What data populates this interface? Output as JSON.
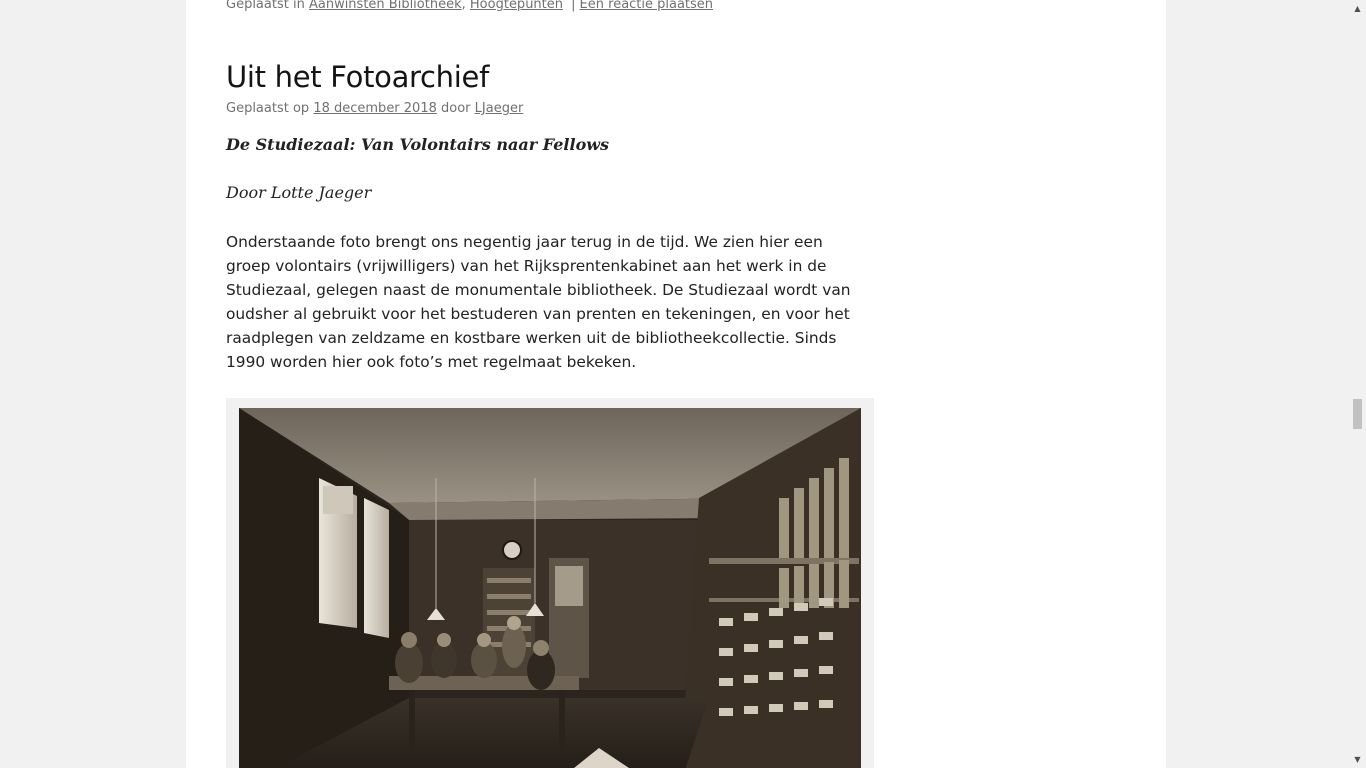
{
  "previous_post": {
    "posted_in_label": "Geplaatst in",
    "categories": [
      "Aanwinsten Bibliotheek",
      "Hoogtepunten"
    ],
    "comma": ",",
    "separator": "|",
    "comment_link": "Een reactie plaatsen"
  },
  "post": {
    "title": "Uit het Fotoarchief",
    "meta": {
      "posted_on_label": "Geplaatst op",
      "date": "18 december 2018",
      "by_label": "door",
      "author": "LJaeger"
    },
    "subtitle": "De Studiezaal: Van Volontairs naar Fellows",
    "byline": "Door Lotte Jaeger",
    "paragraph": "Onderstaande foto brengt ons negentig jaar terug in de tijd. We zien hier een groep volontairs (vrijwilligers) van het Rijksprentenkabinet aan het werk in de Studiezaal, gelegen naast de monumentale bibliotheek. De Studiezaal wordt van oudsher al gebruikt voor het bestuderen van prenten en tekeningen, en voor het raadplegen van zeldzame en kostbare werken uit de bibliotheekcollectie. Sinds 1990 worden hier ook foto’s met regelmaat bekeken."
  },
  "scrollbar": {
    "up_icon": "▲",
    "down_icon": "▼"
  },
  "colors": {
    "page_background": "#f1f1f1",
    "content_background": "#ffffff",
    "meta_text": "#707070",
    "title_text": "#141414",
    "body_text": "#222222"
  }
}
